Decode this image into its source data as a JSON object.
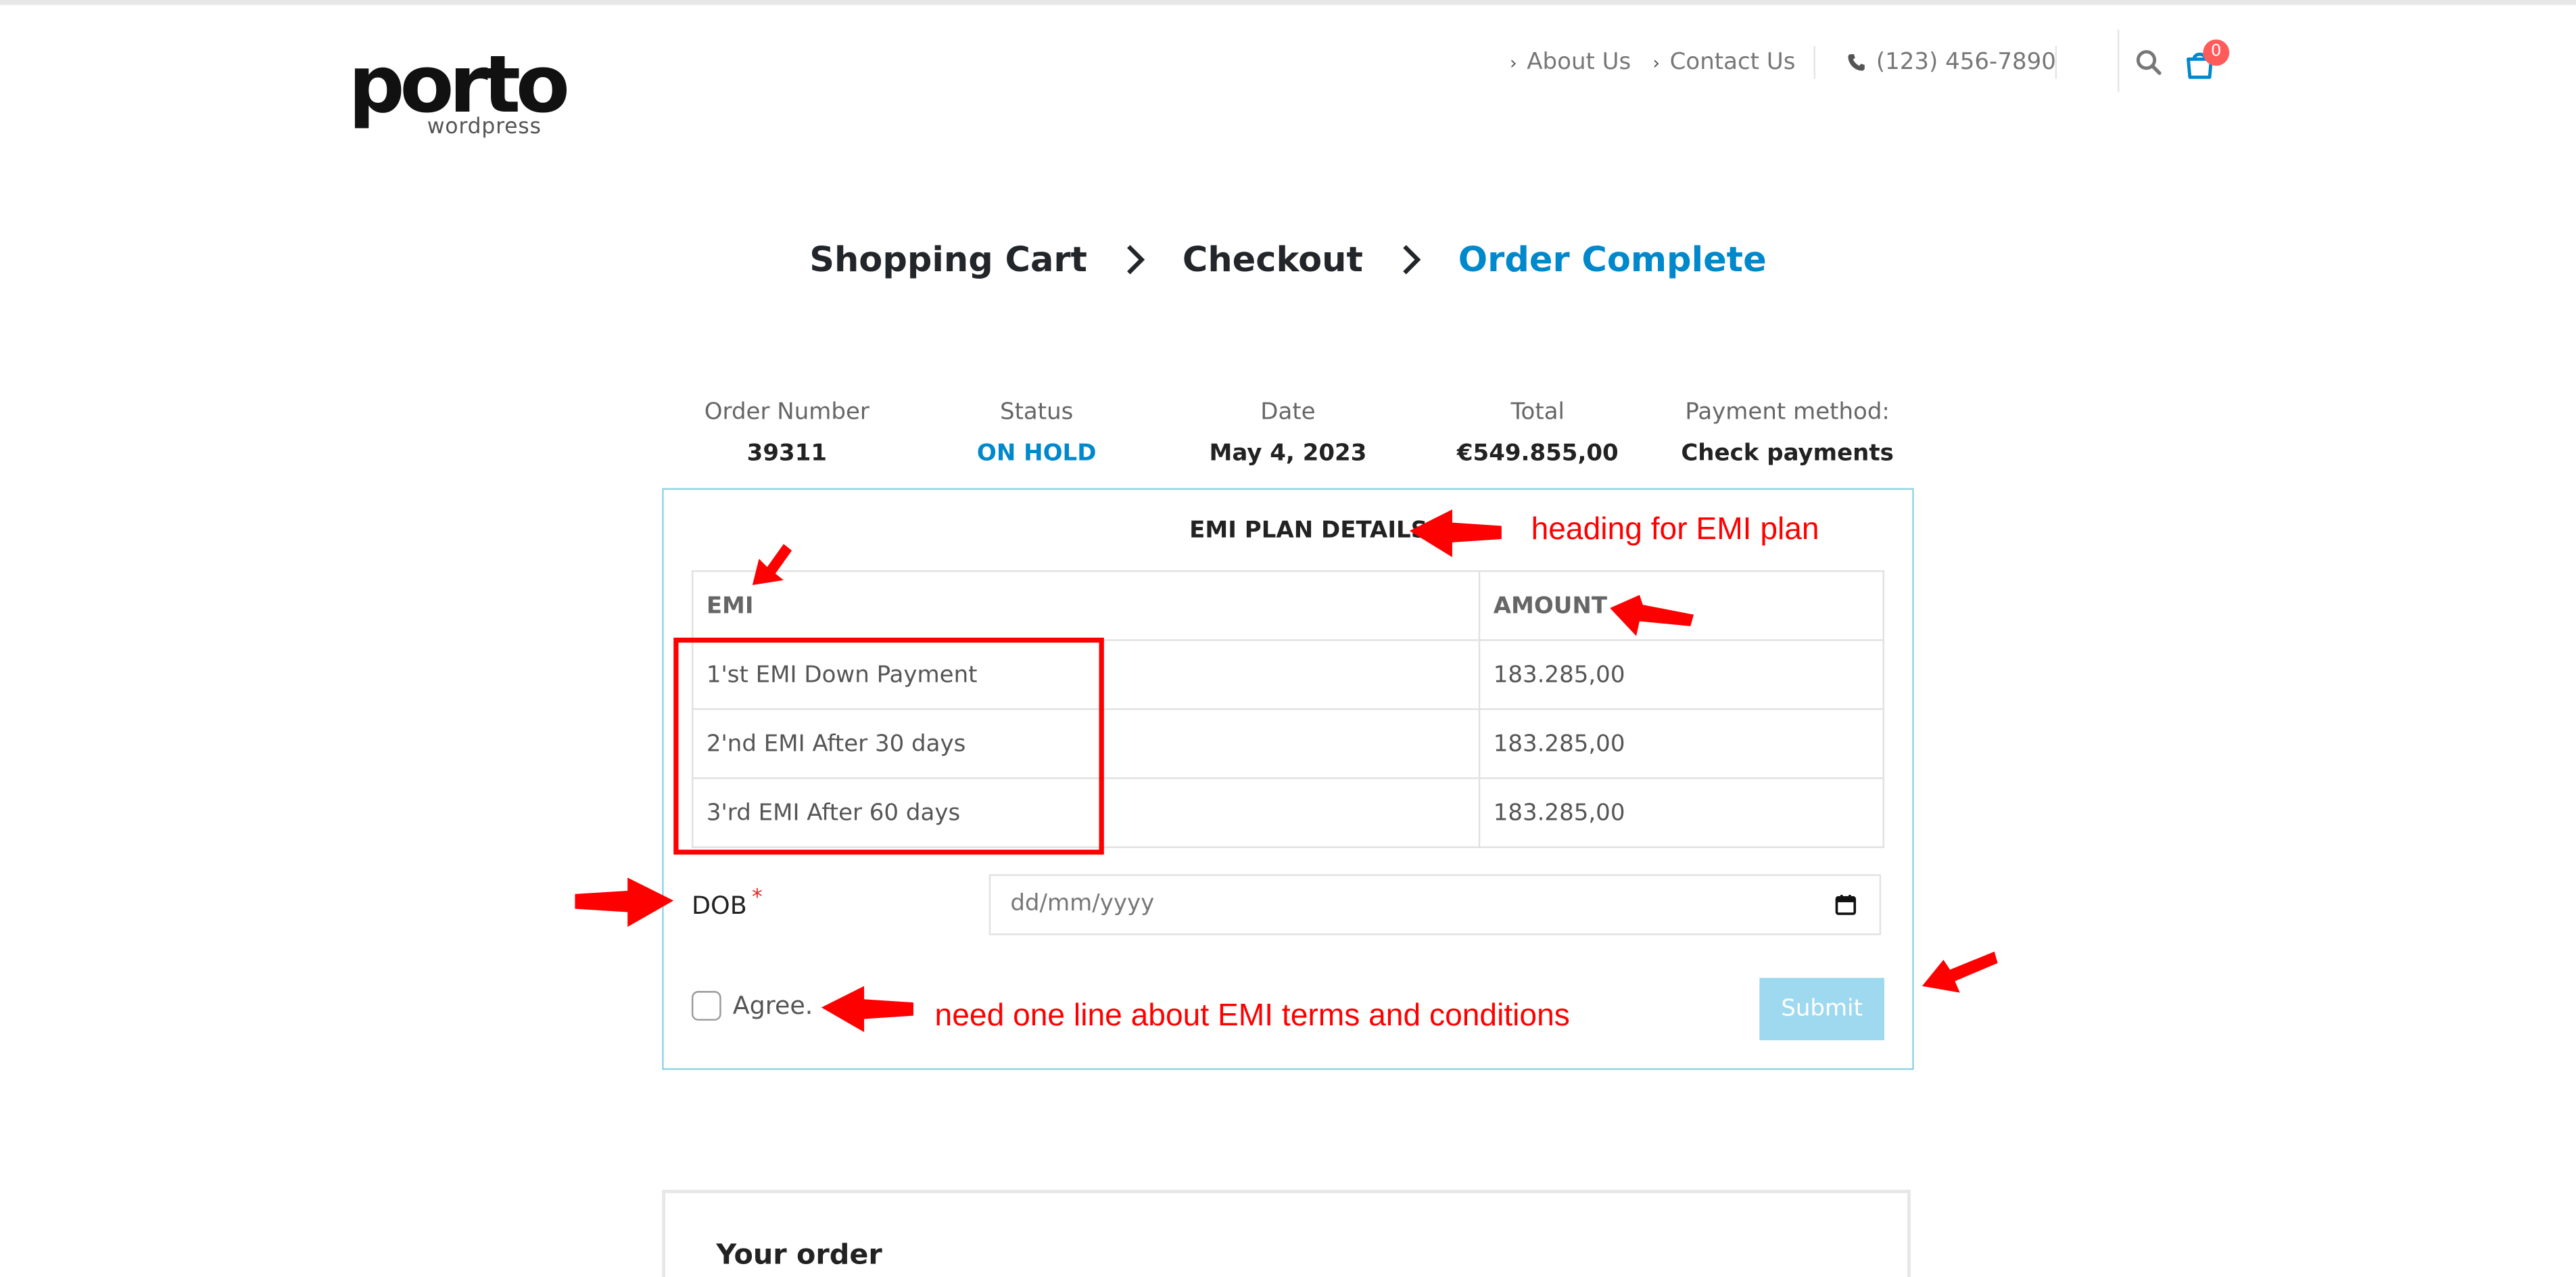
{
  "header": {
    "logo_main": "porto",
    "logo_sub": "wordpress",
    "nav_about": "About Us",
    "nav_contact": "Contact Us",
    "phone": "(123) 456-7890",
    "cart_count": "0"
  },
  "steps": [
    {
      "label": "Shopping Cart"
    },
    {
      "label": "Checkout"
    },
    {
      "label": "Order Complete"
    }
  ],
  "overview": {
    "order_number_label": "Order Number",
    "order_number": "39311",
    "status_label": "Status",
    "status": "ON HOLD",
    "date_label": "Date",
    "date": "May 4, 2023",
    "total_label": "Total",
    "total": "€549.855,00",
    "payment_label": "Payment method:",
    "payment": "Check payments"
  },
  "emi": {
    "heading": "EMI PLAN DETAILS",
    "col_emi": "EMI",
    "col_amount": "AMOUNT",
    "rows": [
      {
        "label": "1'st EMI Down Payment",
        "amount": "183.285,00"
      },
      {
        "label": "2'nd EMI After 30 days",
        "amount": "183.285,00"
      },
      {
        "label": "3'rd EMI After 60 days",
        "amount": "183.285,00"
      }
    ],
    "dob_label": "DOB",
    "dob_required": "*",
    "dob_placeholder": "dd/mm/yyyy",
    "agree_label": "Agree.",
    "submit_label": "Submit"
  },
  "annotations": {
    "heading_note": "heading for EMI plan",
    "terms_note": "need one line about EMI terms and conditions"
  },
  "your_order": {
    "title": "Your order"
  },
  "colors": {
    "accent": "#0088cc",
    "annotation": "#ff0000",
    "badge": "#ff5b5b"
  }
}
